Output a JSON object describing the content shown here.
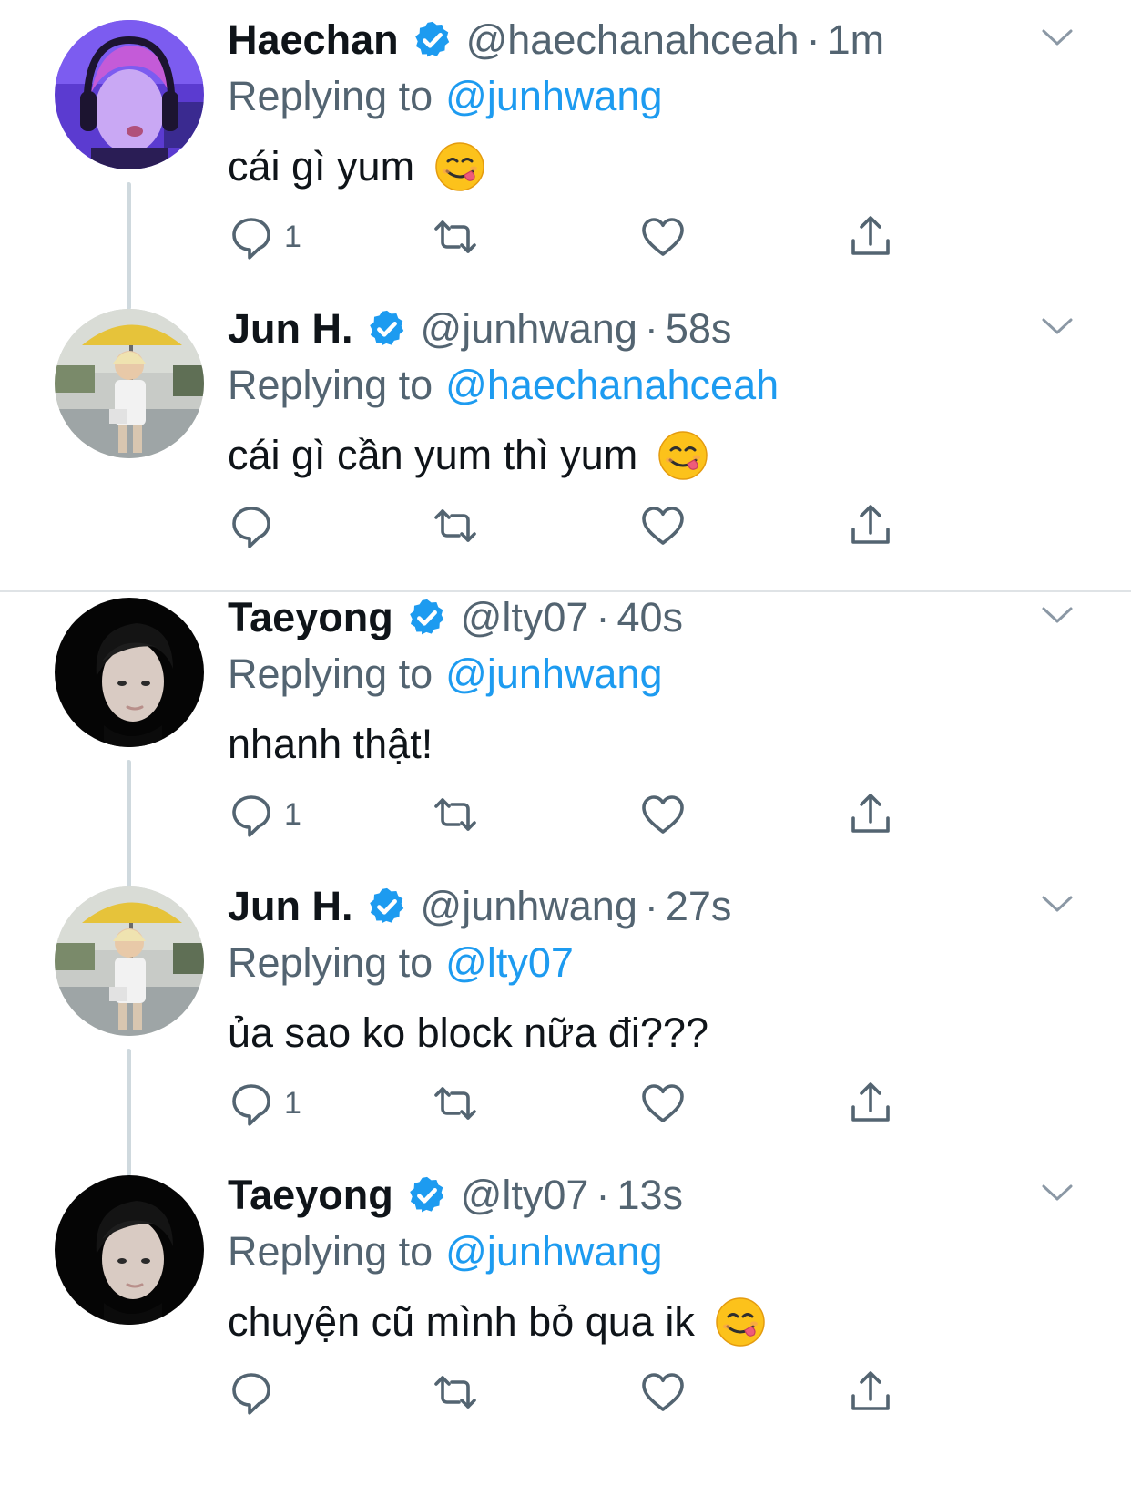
{
  "colors": {
    "verified": "#1d9bf0",
    "link": "#1d9bf0",
    "secondary": "#536471",
    "thread_line": "#cfd9de"
  },
  "tweets": [
    {
      "name": "Haechan",
      "handle": "@haechanahceah",
      "time": "1m",
      "replying_label": "Replying to",
      "reply_to": "@junhwang",
      "text": "cái gì yum",
      "emoji": "yum-face-emoji",
      "reply_count": "1",
      "avatar": "avatar-purple-boy"
    },
    {
      "name": "Jun H.",
      "handle": "@junhwang",
      "time": "58s",
      "replying_label": "Replying to",
      "reply_to": "@haechanahceah",
      "text": "cái gì cần yum thì yum",
      "emoji": "yum-face-emoji",
      "reply_count": "",
      "avatar": "avatar-poolside-boy"
    },
    {
      "name": "Taeyong",
      "handle": "@lty07",
      "time": "40s",
      "replying_label": "Replying to",
      "reply_to": "@junhwang",
      "text": "nhanh thật!",
      "emoji": "",
      "reply_count": "1",
      "avatar": "avatar-dark-portrait"
    },
    {
      "name": "Jun H.",
      "handle": "@junhwang",
      "time": "27s",
      "replying_label": "Replying to",
      "reply_to": "@lty07",
      "text": "ủa sao ko block nữa đi???",
      "emoji": "",
      "reply_count": "1",
      "avatar": "avatar-poolside-boy"
    },
    {
      "name": "Taeyong",
      "handle": "@lty07",
      "time": "13s",
      "replying_label": "Replying to",
      "reply_to": "@junhwang",
      "text": "chuyện cũ mình bỏ qua ik",
      "emoji": "yum-face-emoji",
      "reply_count": "",
      "avatar": "avatar-dark-portrait"
    }
  ]
}
